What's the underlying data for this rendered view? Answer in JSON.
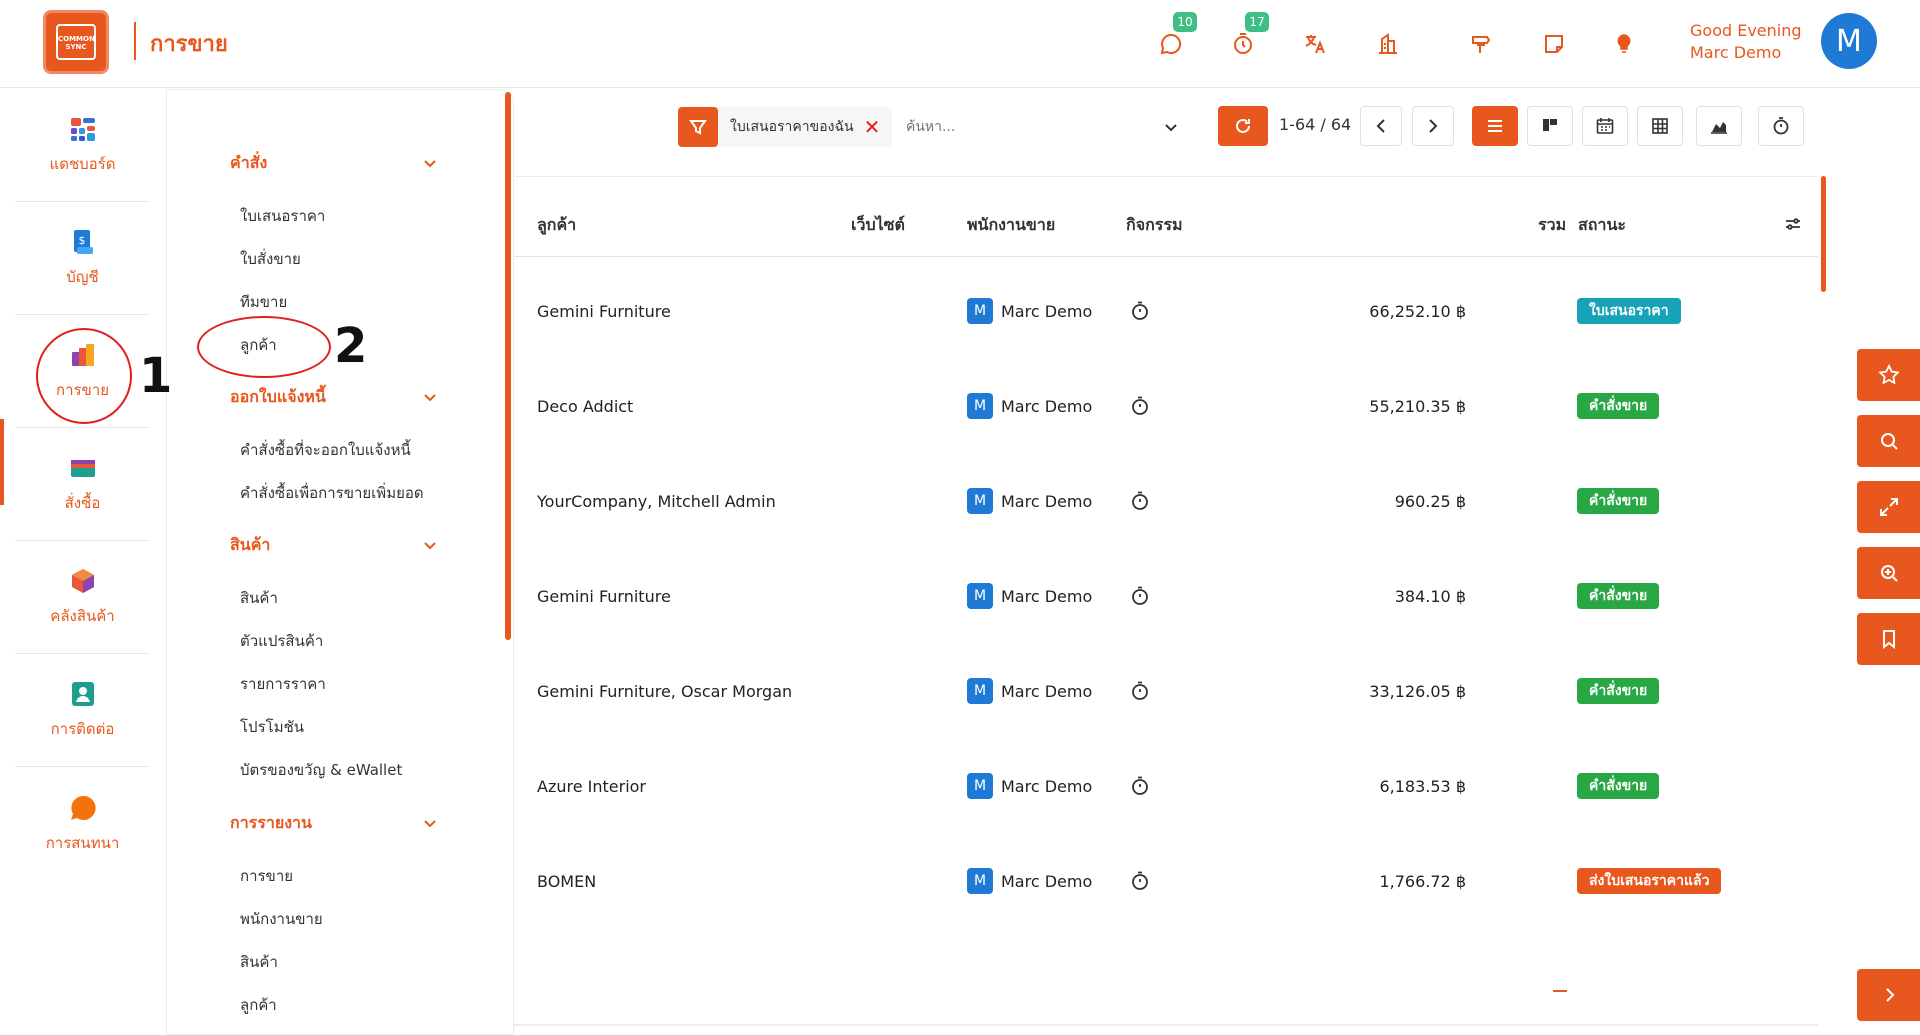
{
  "app": {
    "title": "การขาย",
    "logo_text": "COMMON SYNC"
  },
  "topbar": {
    "messages_badge": "10",
    "activities_badge": "17",
    "greeting_line1": "Good Evening",
    "greeting_line2": "Marc Demo",
    "avatar_initial": "M"
  },
  "rail": {
    "items": [
      {
        "label": "แดชบอร์ด",
        "icon": "dashboard-icon"
      },
      {
        "label": "บัญชี",
        "icon": "accounting-icon"
      },
      {
        "label": "การขาย",
        "icon": "sales-icon"
      },
      {
        "label": "สั่งซื้อ",
        "icon": "purchase-icon"
      },
      {
        "label": "คลังสินค้า",
        "icon": "inventory-icon"
      },
      {
        "label": "การติดต่อ",
        "icon": "contacts-icon"
      },
      {
        "label": "การสนทนา",
        "icon": "discuss-icon"
      }
    ]
  },
  "submenu": {
    "sections": [
      {
        "title": "คำสั่ง",
        "items": [
          "ใบเสนอราคา",
          "ใบสั่งขาย",
          "ทีมขาย",
          "ลูกค้า"
        ]
      },
      {
        "title": "ออกใบแจ้งหนี้",
        "items": [
          "คำสั่งซื้อที่จะออกใบแจ้งหนี้",
          "คำสั่งซื้อเพื่อการขายเพิ่มยอด"
        ]
      },
      {
        "title": "สินค้า",
        "items": [
          "สินค้า",
          "ตัวแปรสินค้า",
          "รายการราคา",
          "โปรโมชัน",
          "บัตรของขวัญ & eWallet"
        ]
      },
      {
        "title": "การรายงาน",
        "items": [
          "การขาย",
          "พนักงานขาย",
          "สินค้า",
          "ลูกค้า"
        ]
      }
    ]
  },
  "annotations": {
    "one": "1",
    "two": "2"
  },
  "toolbar": {
    "filter_label": "ใบเสนอราคาของฉัน",
    "search_placeholder": "ค้นหา...",
    "pager_text": "1-64 / 64"
  },
  "table": {
    "headers": {
      "customer": "ลูกค้า",
      "website": "เว็บไซต์",
      "salesperson": "พนักงานขาย",
      "activity": "กิจกรรม",
      "total": "รวม",
      "status": "สถานะ"
    },
    "rows": [
      {
        "customer": "Gemini Furniture",
        "rep_initial": "M",
        "rep": "Marc Demo",
        "total": "66,252.10 ฿",
        "status": "ใบเสนอราคา",
        "status_color": "#17a2b8"
      },
      {
        "customer": "Deco Addict",
        "rep_initial": "M",
        "rep": "Marc Demo",
        "total": "55,210.35 ฿",
        "status": "คำสั่งขาย",
        "status_color": "#28a745"
      },
      {
        "customer": "YourCompany, Mitchell Admin",
        "rep_initial": "M",
        "rep": "Marc Demo",
        "total": "960.25 ฿",
        "status": "คำสั่งขาย",
        "status_color": "#28a745"
      },
      {
        "customer": "Gemini Furniture",
        "rep_initial": "M",
        "rep": "Marc Demo",
        "total": "384.10 ฿",
        "status": "คำสั่งขาย",
        "status_color": "#28a745"
      },
      {
        "customer": "Gemini Furniture, Oscar Morgan",
        "rep_initial": "M",
        "rep": "Marc Demo",
        "total": "33,126.05 ฿",
        "status": "คำสั่งขาย",
        "status_color": "#28a745"
      },
      {
        "customer": "Azure Interior",
        "rep_initial": "M",
        "rep": "Marc Demo",
        "total": "6,183.53 ฿",
        "status": "คำสั่งขาย",
        "status_color": "#28a745"
      },
      {
        "customer": "BOMEN",
        "rep_initial": "M",
        "rep": "Marc Demo",
        "total": "1,766.72 ฿",
        "status": "ส่งใบเสนอราคาแล้ว",
        "status_color": "#e8571e"
      }
    ]
  },
  "colors": {
    "accent": "#e8571e",
    "avatar_blue": "#1f7ad6",
    "badge_green": "#3fbf85"
  }
}
